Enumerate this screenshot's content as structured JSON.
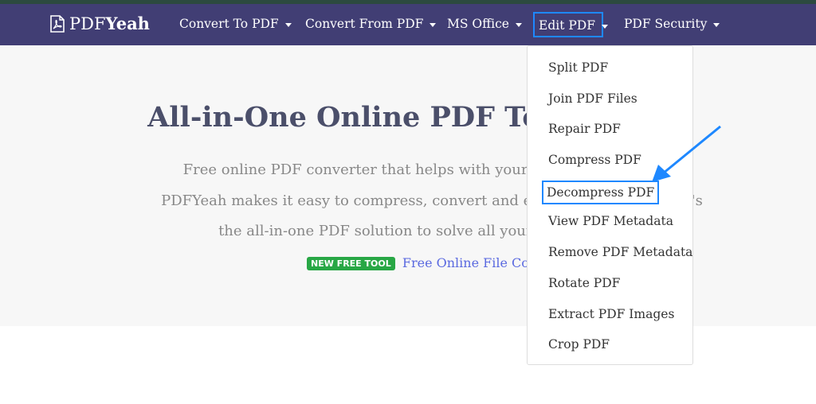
{
  "brand": {
    "prefix": "PDF",
    "suffix": "Yeah"
  },
  "nav": [
    {
      "label": "Convert To PDF"
    },
    {
      "label": "Convert From PDF"
    },
    {
      "label": "MS Office"
    },
    {
      "label": "Edit PDF"
    },
    {
      "label": "PDF Security"
    }
  ],
  "hero": {
    "title": "All-in-One Online PDF Tools",
    "description": "Free online PDF converter that helps with your everyday PDF tasks. PDFYeah makes it easy to compress, convert and edit PDF files online. It's the all-in-one PDF solution to solve all your PDF problems.",
    "badge": "NEW FREE TOOL",
    "promo_link": "Free Online File Compressor"
  },
  "dropdown": [
    "Split PDF",
    "Join PDF Files",
    "Repair PDF",
    "Compress PDF",
    "Decompress PDF",
    "View PDF Metadata",
    "Remove PDF Metadata",
    "Rotate PDF",
    "Extract PDF Images",
    "Crop PDF"
  ],
  "colors": {
    "nav_bg": "#413e74",
    "highlight": "#1e88ff",
    "badge": "#28a745"
  }
}
